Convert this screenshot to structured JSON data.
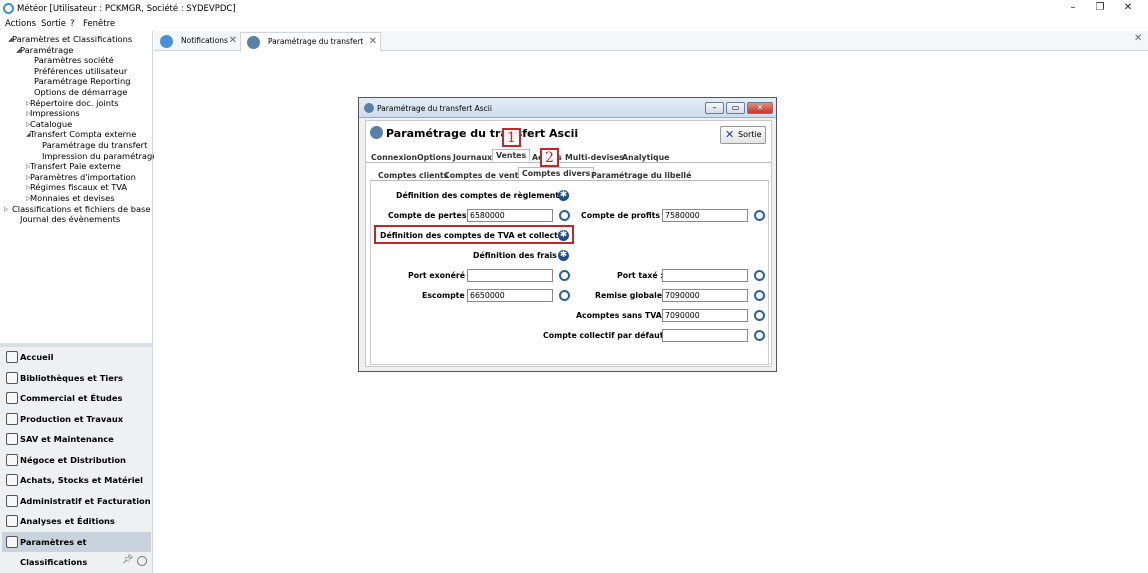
{
  "window": {
    "title": "Météor [Utilisateur : PCKMGR, Société : SYDEVPDC]",
    "minimize": "–",
    "maximize": "❐",
    "close": "✕"
  },
  "menubar": [
    "Actions",
    "Sortie",
    "?",
    "Fenêtre"
  ],
  "tree": [
    {
      "label": "Paramètres et Classifications",
      "caret": "◢"
    },
    {
      "label": "Paramétrage",
      "caret": "◢"
    },
    {
      "label": "Paramètres société",
      "caret": ""
    },
    {
      "label": "Préférences utilisateur",
      "caret": ""
    },
    {
      "label": "Paramétrage Reporting",
      "caret": ""
    },
    {
      "label": "Options de démarrage",
      "caret": ""
    },
    {
      "label": "Répertoire doc. joints",
      "caret": "▷"
    },
    {
      "label": "Impressions",
      "caret": "▷"
    },
    {
      "label": "Catalogue",
      "caret": "▷"
    },
    {
      "label": "Transfert Compta externe",
      "caret": "◢"
    },
    {
      "label": "Paramétrage du transfert",
      "caret": ""
    },
    {
      "label": "Impression du paramétrage",
      "caret": ""
    },
    {
      "label": "Transfert Paie externe",
      "caret": "▷"
    },
    {
      "label": "Paramètres d'importation",
      "caret": "▷"
    },
    {
      "label": "Régimes fiscaux et TVA",
      "caret": "▷"
    },
    {
      "label": "Monnaies et devises",
      "caret": "▷"
    },
    {
      "label": "Classifications et fichiers de base",
      "caret": "▷"
    },
    {
      "label": "Journal des évènements",
      "caret": ""
    }
  ],
  "modules": [
    {
      "label": "Accueil"
    },
    {
      "label": "Bibliothèques et Tiers"
    },
    {
      "label": "Commercial et Études"
    },
    {
      "label": "Production et Travaux"
    },
    {
      "label": "SAV et Maintenance"
    },
    {
      "label": "Négoce et Distribution"
    },
    {
      "label": "Achats, Stocks et Matériel"
    },
    {
      "label": "Administratif et Facturation"
    },
    {
      "label": "Analyses et Éditions"
    },
    {
      "label": "Paramètres et Classifications"
    }
  ],
  "tabs": [
    {
      "label": "Notifications",
      "close": "✕"
    },
    {
      "label": "Paramétrage du transfert Ascii",
      "close": "✕"
    }
  ],
  "workspace_close": "✕",
  "dialog": {
    "title": "Paramétrage du transfert Ascii",
    "header_title": "Paramétrage du transfert Ascii",
    "sortie": "Sortie",
    "main_tabs": [
      "Connexion",
      "Options",
      "Journaux",
      "Ventes",
      "Achats",
      "Multi-devises",
      "Analytique"
    ],
    "sub_tabs": [
      "Comptes clients",
      "Comptes de vente",
      "Comptes divers",
      "Paramétrage du libellé"
    ],
    "fields": {
      "def_reglements": "Définition des comptes de règlements :",
      "compte_pertes_label": "Compte de pertes :",
      "compte_pertes": "6580000",
      "compte_profits_label": "Compte de profits :",
      "compte_profits": "7580000",
      "def_tva": "Définition des comptes de TVA et collectifs",
      "def_frais": "Définition des frais :",
      "port_exonere_label": "Port exonéré :",
      "port_exonere": "",
      "port_taxe_label": "Port taxé :",
      "port_taxe": "",
      "escompte_label": "Escompte :",
      "escompte": "6650000",
      "remise_label": "Remise globale :",
      "remise": "7090000",
      "acomptes_label": "Acomptes sans TVA :",
      "acomptes": "7090000",
      "collectif_label": "Compte collectif par défaut :",
      "collectif": ""
    }
  },
  "annotations": [
    "1",
    "2"
  ]
}
